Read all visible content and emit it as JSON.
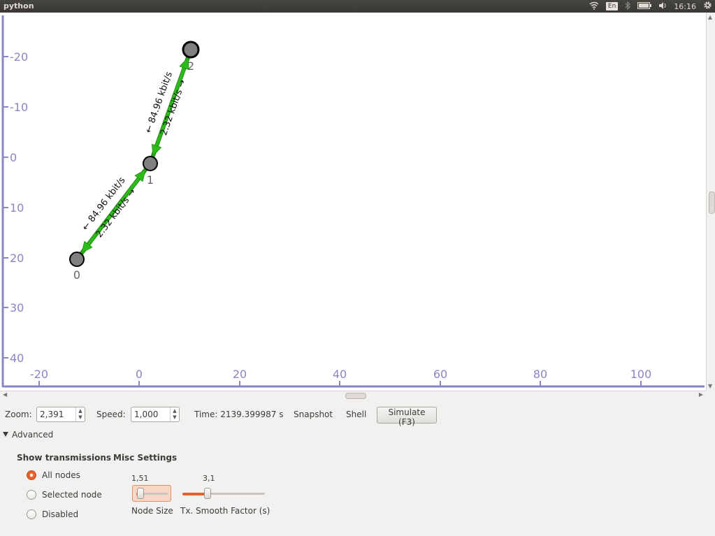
{
  "window": {
    "title": "python"
  },
  "tray": {
    "lang": "En",
    "clock": "16:16"
  },
  "axes": {
    "x_ticks": [
      "-20",
      "0",
      "20",
      "40",
      "60",
      "80",
      "100"
    ],
    "y_ticks": [
      "-20",
      "-10",
      "0",
      "10",
      "20",
      "30",
      "40"
    ],
    "color": "#8886c3"
  },
  "graph": {
    "nodes": [
      {
        "id": "0",
        "label": "0"
      },
      {
        "id": "1",
        "label": "1"
      },
      {
        "id": "2",
        "label": "2"
      }
    ],
    "links": [
      {
        "from": "0",
        "to": "1",
        "forward_label": "2.32 kbit/s →",
        "backward_label": "← 84.96 kbit/s"
      },
      {
        "from": "1",
        "to": "2",
        "forward_label": "2.32 kbit/s →",
        "backward_label": "← 84.96 kbit/s"
      }
    ],
    "link_color": "#2dbb19",
    "node_color": "#808080"
  },
  "controls": {
    "zoom_label": "Zoom:",
    "zoom_value": "2,391",
    "speed_label": "Speed:",
    "speed_value": "1,000",
    "time_text": "Time: 2139.399987 s",
    "snapshot_label": "Snapshot",
    "shell_label": "Shell",
    "simulate_label": "Simulate (F3)"
  },
  "advanced": {
    "label": "Advanced",
    "show_transmissions": {
      "header": "Show transmissions",
      "options": [
        "All nodes",
        "Selected node",
        "Disabled"
      ],
      "selected": "All nodes"
    },
    "misc_settings": {
      "header": "Misc Settings",
      "node_size": {
        "label": "Node Size",
        "value": "1,51"
      },
      "smooth_factor": {
        "label": "Tx. Smooth Factor (s)",
        "value": "3,1"
      }
    }
  }
}
